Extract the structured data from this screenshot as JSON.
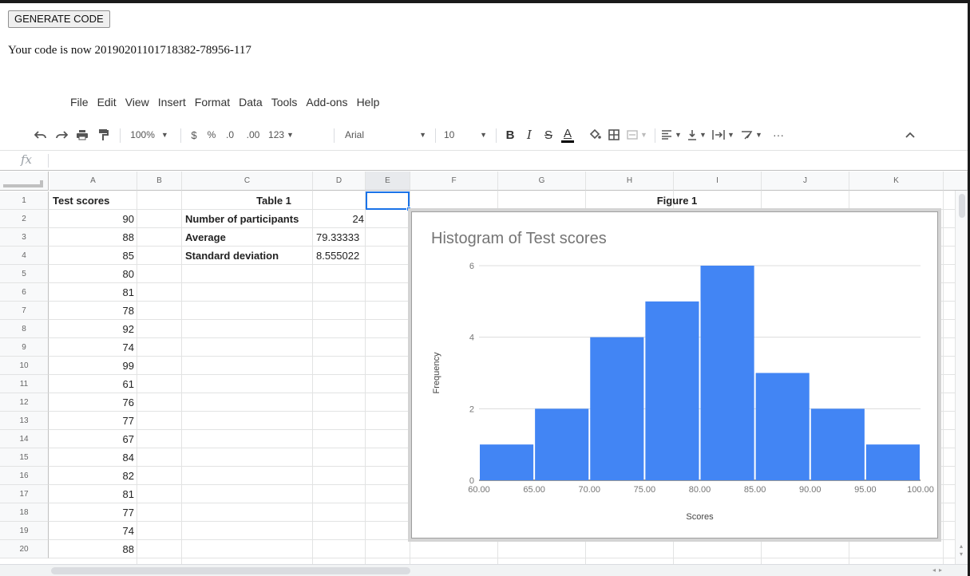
{
  "page": {
    "generate_button": "GENERATE CODE",
    "code_message": "Your code is now 20190201101718382-78956-117"
  },
  "menu": [
    "File",
    "Edit",
    "View",
    "Insert",
    "Format",
    "Data",
    "Tools",
    "Add-ons",
    "Help"
  ],
  "toolbar": {
    "zoom": "100%",
    "currency": "$",
    "percent": "%",
    "decrease_decimals": ".0",
    "increase_decimals": ".00",
    "more_formats": "123",
    "font": "Arial",
    "font_size": "10",
    "bold": "B",
    "italic": "I",
    "strikethrough": "S",
    "text_color": "A",
    "more": "···",
    "icons": [
      "undo-icon",
      "redo-icon",
      "print-icon",
      "paint-format-icon",
      "fill-color-icon",
      "borders-icon",
      "merge-cells-icon",
      "align-icon",
      "valign-icon",
      "text-rotation-icon",
      "filter-icon",
      "collapse-icon"
    ]
  },
  "formula_bar": {
    "fx_label": "fx",
    "value": ""
  },
  "columns": [
    "A",
    "B",
    "C",
    "D",
    "E",
    "F",
    "G",
    "H",
    "I",
    "J",
    "K"
  ],
  "rows": [
    "1",
    "2",
    "3",
    "4",
    "5",
    "6",
    "7",
    "8",
    "9",
    "10",
    "11",
    "12",
    "13",
    "14",
    "15",
    "16",
    "17",
    "18",
    "19",
    "20"
  ],
  "sheet": {
    "a_header": "Test scores",
    "scores": [
      "90",
      "88",
      "85",
      "80",
      "81",
      "78",
      "92",
      "74",
      "99",
      "61",
      "76",
      "77",
      "67",
      "84",
      "82",
      "81",
      "77",
      "74",
      "88"
    ],
    "table_title": "Table 1",
    "table_rows": [
      {
        "label": "Number of participants",
        "value": "24"
      },
      {
        "label": "Average",
        "value": "79.33333"
      },
      {
        "label": "Standard deviation",
        "value": "8.555022"
      }
    ],
    "figure_title": "Figure 1"
  },
  "chart_data": {
    "type": "bar",
    "title": "Histogram of Test scores",
    "xlabel": "Scores",
    "ylabel": "Frequency",
    "bins": [
      {
        "from": 60,
        "to": 65,
        "value": 1
      },
      {
        "from": 65,
        "to": 70,
        "value": 2
      },
      {
        "from": 70,
        "to": 75,
        "value": 4
      },
      {
        "from": 75,
        "to": 80,
        "value": 5
      },
      {
        "from": 80,
        "to": 85,
        "value": 6
      },
      {
        "from": 85,
        "to": 90,
        "value": 3
      },
      {
        "from": 90,
        "to": 95,
        "value": 2
      },
      {
        "from": 95,
        "to": 100,
        "value": 1
      }
    ],
    "x_ticks": [
      "60.00",
      "65.00",
      "70.00",
      "75.00",
      "80.00",
      "85.00",
      "90.00",
      "95.00",
      "100.00"
    ],
    "y_ticks": [
      "0",
      "2",
      "4",
      "6"
    ],
    "ylim": [
      0,
      6
    ],
    "xlim": [
      60,
      100
    ],
    "bar_color": "#4285f4",
    "grid": true
  }
}
